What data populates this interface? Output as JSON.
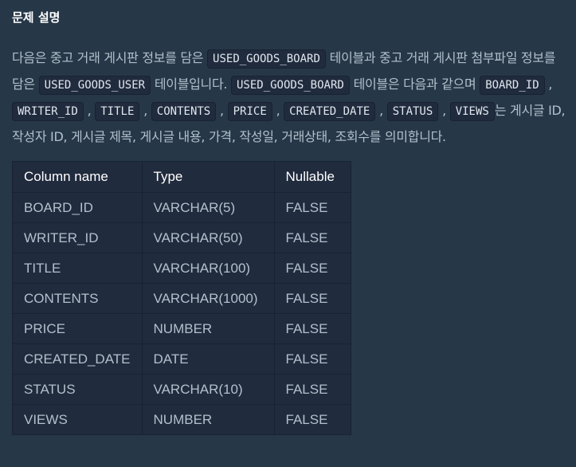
{
  "section_title": "문제 설명",
  "description": {
    "t1": "다음은 중고 거래 게시판 정보를 담은 ",
    "code1": "USED_GOODS_BOARD",
    "t2": " 테이블과 중고 거래 게시판 첨부파일 정보를 담은 ",
    "code2": "USED_GOODS_USER",
    "t3": " 테이블입니다. ",
    "code3": "USED_GOODS_BOARD",
    "t4": " 테이블은 다음과 같으며 ",
    "columns": [
      "BOARD_ID",
      "WRITER_ID",
      "TITLE",
      "CONTENTS",
      "PRICE",
      "CREATED_DATE",
      "STATUS",
      "VIEWS"
    ],
    "separator": ",",
    "t5": "는 게시글 ID, 작성자 ID, 게시글 제목, 게시글 내용, 가격, 작성일, 거래상태, 조회수를 의미합니다."
  },
  "table": {
    "headers": [
      "Column name",
      "Type",
      "Nullable"
    ],
    "rows": [
      [
        "BOARD_ID",
        "VARCHAR(5)",
        "FALSE"
      ],
      [
        "WRITER_ID",
        "VARCHAR(50)",
        "FALSE"
      ],
      [
        "TITLE",
        "VARCHAR(100)",
        "FALSE"
      ],
      [
        "CONTENTS",
        "VARCHAR(1000)",
        "FALSE"
      ],
      [
        "PRICE",
        "NUMBER",
        "FALSE"
      ],
      [
        "CREATED_DATE",
        "DATE",
        "FALSE"
      ],
      [
        "STATUS",
        "VARCHAR(10)",
        "FALSE"
      ],
      [
        "VIEWS",
        "NUMBER",
        "FALSE"
      ]
    ]
  }
}
